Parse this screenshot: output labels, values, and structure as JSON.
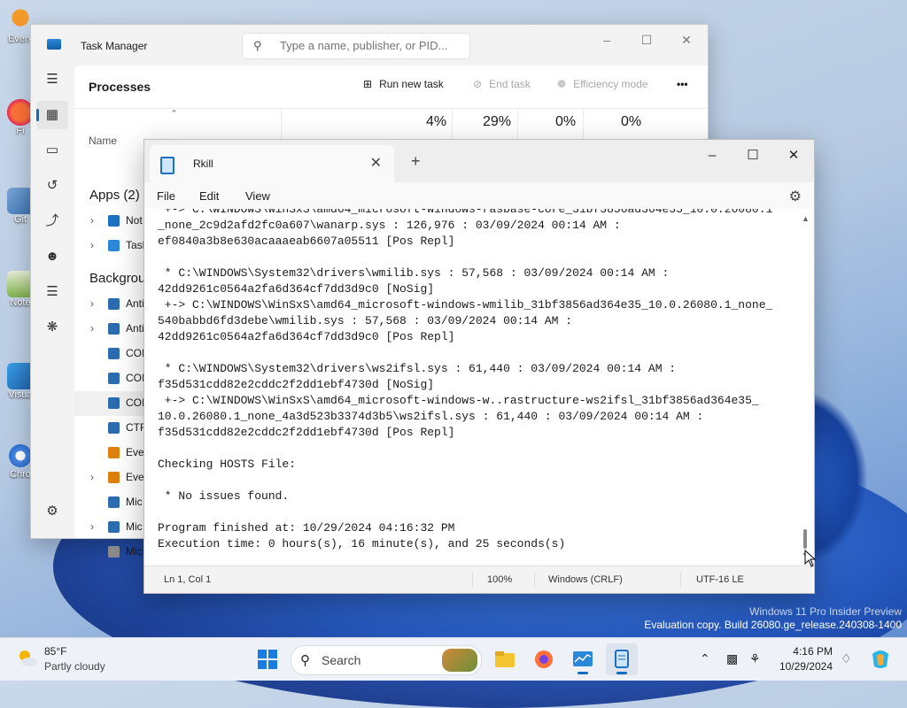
{
  "desktop": {
    "icons": [
      {
        "name": "everything-icon",
        "label": "Every"
      },
      {
        "name": "firefox-icon",
        "label": "Fi"
      },
      {
        "name": "git-icon",
        "label": "Git"
      },
      {
        "name": "notepad-icon",
        "label": "Note"
      },
      {
        "name": "visual-studio-icon",
        "label": "Visua"
      },
      {
        "name": "chrome-icon",
        "label": "Chro"
      }
    ],
    "watermark": {
      "line1": "Windows 11 Pro Insider Preview",
      "line2": "Evaluation copy. Build 26080.ge_release.240308-1400"
    }
  },
  "task_manager": {
    "title": "Task Manager",
    "search_placeholder": "Type a name, publisher, or PID...",
    "page_title": "Processes",
    "toolbar": {
      "run_new_task": "Run new task",
      "end_task": "End task",
      "efficiency_mode": "Efficiency mode",
      "more": "•••"
    },
    "columns": {
      "name": "Name",
      "cpu_pct": "4%",
      "memory_pct": "29%",
      "disk_pct": "0%",
      "network_pct": "0%"
    },
    "sections": {
      "apps": "Apps (2)",
      "background": "Backgrou"
    },
    "app_rows": [
      {
        "label": "Not",
        "expandable": true
      },
      {
        "label": "Task",
        "expandable": true
      }
    ],
    "background_rows": [
      {
        "label": "Anti",
        "expandable": true
      },
      {
        "label": "Anti",
        "expandable": true
      },
      {
        "label": "COI",
        "expandable": false
      },
      {
        "label": "COI",
        "expandable": false
      },
      {
        "label": "COI",
        "expandable": false
      },
      {
        "label": "CTF",
        "expandable": false
      },
      {
        "label": "Ever",
        "expandable": false
      },
      {
        "label": "Ever",
        "expandable": true
      },
      {
        "label": "Mic",
        "expandable": false
      },
      {
        "label": "Mic",
        "expandable": true
      },
      {
        "label": "Mic",
        "expandable": false
      }
    ]
  },
  "notepad": {
    "tab_title": "Rkill",
    "menu": {
      "file": "File",
      "edit": "Edit",
      "view": "View"
    },
    "content": " +-> C:\\WINDOWS\\WinSxS\\amd64_microsoft-windows-rasbase-core_31bf3856ad364e35_10.0.26080.1\n_none_2c9d2afd2fc0a607\\wanarp.sys : 126,976 : 03/09/2024 00:14 AM :\nef0840a3b8e630acaaaeab6607a05511 [Pos Repl]\n\n * C:\\WINDOWS\\System32\\drivers\\wmilib.sys : 57,568 : 03/09/2024 00:14 AM :\n42dd9261c0564a2fa6d364cf7dd3d9c0 [NoSig]\n +-> C:\\WINDOWS\\WinSxS\\amd64_microsoft-windows-wmilib_31bf3856ad364e35_10.0.26080.1_none_\n540babbd6fd3debe\\wmilib.sys : 57,568 : 03/09/2024 00:14 AM :\n42dd9261c0564a2fa6d364cf7dd3d9c0 [Pos Repl]\n\n * C:\\WINDOWS\\System32\\drivers\\ws2ifsl.sys : 61,440 : 03/09/2024 00:14 AM :\nf35d531cdd82e2cddc2f2dd1ebf4730d [NoSig]\n +-> C:\\WINDOWS\\WinSxS\\amd64_microsoft-windows-w..rastructure-ws2ifsl_31bf3856ad364e35_\n10.0.26080.1_none_4a3d523b3374d3b5\\ws2ifsl.sys : 61,440 : 03/09/2024 00:14 AM :\nf35d531cdd82e2cddc2f2dd1ebf4730d [Pos Repl]\n\nChecking HOSTS File:\n\n * No issues found.\n\nProgram finished at: 10/29/2024 04:16:32 PM\nExecution time: 0 hours(s), 16 minute(s), and 25 seconds(s)",
    "status": {
      "position": "Ln 1, Col 1",
      "zoom": "100%",
      "line_ending": "Windows (CRLF)",
      "encoding": "UTF-16 LE"
    }
  },
  "taskbar": {
    "weather": {
      "temp": "85°F",
      "condition": "Partly cloudy"
    },
    "search_label": "Search",
    "pinned": [
      {
        "name": "start-button",
        "active": false
      },
      {
        "name": "file-explorer-icon",
        "active": false
      },
      {
        "name": "firefox-icon",
        "active": false
      },
      {
        "name": "task-manager-icon",
        "active": true
      },
      {
        "name": "notepad-icon",
        "active": true
      }
    ],
    "clock": {
      "time": "4:16 PM",
      "date": "10/29/2024"
    }
  },
  "colors": {
    "accent": "#0f6cbd",
    "notepad_bg": "#ffffff",
    "taskbar_bg": "#eef2f8"
  }
}
